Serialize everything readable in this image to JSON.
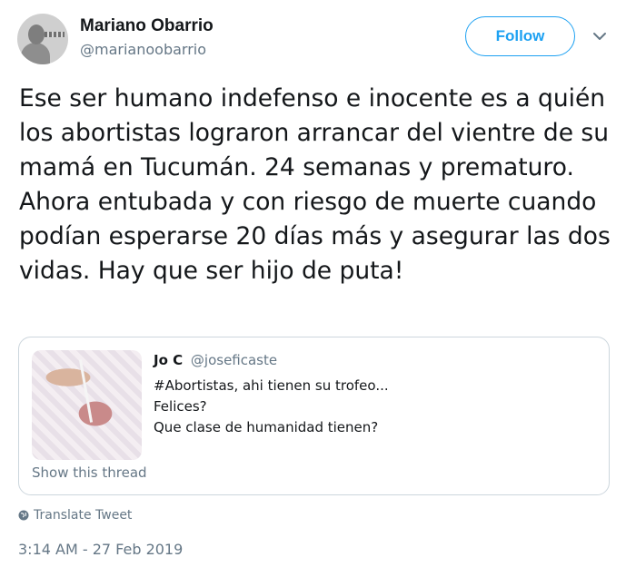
{
  "author": {
    "name": "Mariano Obarrio",
    "handle": "@marianoobarrio",
    "avatar_icon": "avatar-photo"
  },
  "follow_label": "Follow",
  "menu_icon": "chevron-down-icon",
  "tweet": {
    "text": "Ese ser humano indefenso e inocente es a quién los abortistas lograron arrancar del vientre de su mamá en Tucumán. 24 semanas y prematuro. Ahora entubada y con riesgo de muerte cuando podían esperarse 20 días más y asegurar las dos vidas. Hay que ser hijo de puta!"
  },
  "quoted": {
    "name": "Jo C",
    "handle": "@joseficaste",
    "lines": [
      "#Abortistas, ahi tienen su trofeo...",
      "Felices?",
      "Que clase de humanidad tienen?"
    ],
    "show_thread": "Show this thread",
    "image_icon": "newborn-photo"
  },
  "translate_label": "Translate Tweet",
  "timestamp": "3:14 AM - 27 Feb 2019",
  "colors": {
    "accent": "#1da1f2",
    "text": "#14171a",
    "muted": "#657786",
    "border": "#ccd6dd"
  }
}
